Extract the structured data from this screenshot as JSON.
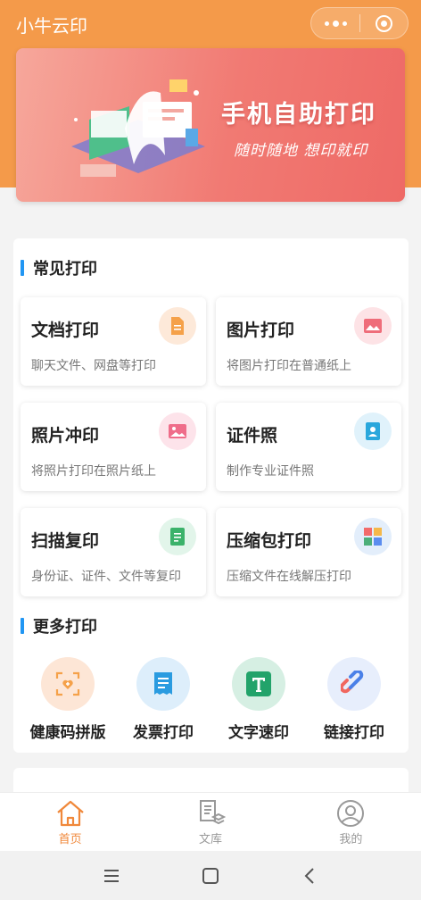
{
  "app": {
    "title": "小牛云印"
  },
  "banner": {
    "title": "手机自助打印",
    "subtitle": "随时随地 想印就印"
  },
  "common": {
    "title": "常见打印",
    "items": [
      {
        "name": "文档打印",
        "desc": "聊天文件、网盘等打印",
        "icon": "document-icon",
        "color": "#f5a149",
        "bg": "#fde9d9"
      },
      {
        "name": "图片打印",
        "desc": "将图片打印在普通纸上",
        "icon": "image-icon",
        "color": "#ef6d7a",
        "bg": "#fde3e6"
      },
      {
        "name": "照片冲印",
        "desc": "将照片打印在照片纸上",
        "icon": "photo-icon",
        "color": "#ef6d8a",
        "bg": "#fde3ea"
      },
      {
        "name": "证件照",
        "desc": "制作专业证件照",
        "icon": "id-photo-icon",
        "color": "#2aa7dc",
        "bg": "#e0f2fb"
      },
      {
        "name": "扫描复印",
        "desc": "身份证、证件、文件等复印",
        "icon": "scan-icon",
        "color": "#3bb26a",
        "bg": "#e2f5ea"
      },
      {
        "name": "压缩包打印",
        "desc": "压缩文件在线解压打印",
        "icon": "archive-icon",
        "color": "#7a9bd9",
        "bg": "#e3eefb"
      }
    ]
  },
  "more": {
    "title": "更多打印",
    "items": [
      {
        "label": "健康码拼版",
        "icon": "health-code-icon",
        "bg": "#fde6d6"
      },
      {
        "label": "发票打印",
        "icon": "invoice-icon",
        "bg": "#ddeefb"
      },
      {
        "label": "文字速印",
        "icon": "text-print-icon",
        "bg": "#d6efe3"
      },
      {
        "label": "链接打印",
        "icon": "link-icon",
        "bg": "#e7eefc"
      }
    ]
  },
  "tabbar": {
    "items": [
      {
        "label": "首页",
        "active": true
      },
      {
        "label": "文库",
        "active": false
      },
      {
        "label": "我的",
        "active": false
      }
    ]
  },
  "colors": {
    "header": "#f49a4a",
    "accent": "#f0883a",
    "section_bar": "#2196f3"
  }
}
